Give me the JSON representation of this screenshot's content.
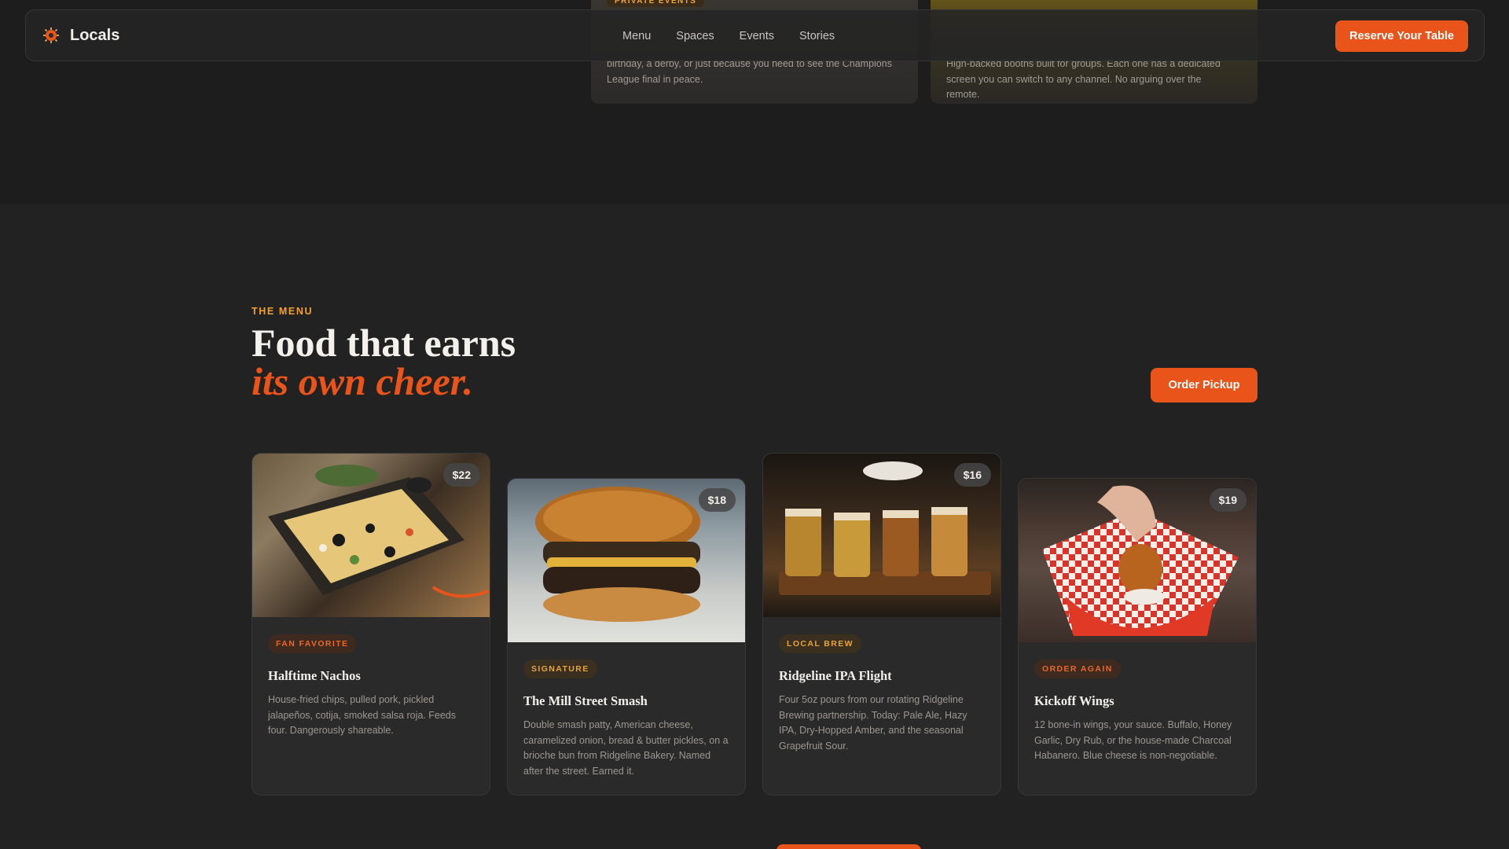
{
  "prev_section": {
    "left_card": {
      "tag": "PRIVATE EVENTS",
      "desc": "birthday, a derby, or just because you need to see the Champions League final in peace."
    },
    "right_card": {
      "desc": "High-backed booths built for groups. Each one has a dedicated screen you can switch to any channel. No arguing over the remote."
    }
  },
  "header": {
    "brand": "Locals",
    "nav": [
      "Menu",
      "Spaces",
      "Events",
      "Stories"
    ],
    "cta": "Reserve Your Table"
  },
  "menu": {
    "eyebrow": "THE MENU",
    "headline_line1": "Food that earns",
    "headline_line2": "its own cheer.",
    "order_button": "Order Pickup",
    "items": [
      {
        "badge": "FAN FAVORITE",
        "name": "Halftime Nachos",
        "price": "$22",
        "desc": "House-fried chips, pulled pork, pickled jalapeños, cotija, smoked salsa roja. Feeds four. Dangerously shareable."
      },
      {
        "badge": "SIGNATURE",
        "name": "The Mill Street Smash",
        "price": "$18",
        "desc": "Double smash patty, American cheese, caramelized onion, bread & butter pickles, on a brioche bun from Ridgeline Bakery. Named after the street. Earned it."
      },
      {
        "badge": "LOCAL BREW",
        "name": "Ridgeline IPA Flight",
        "price": "$16",
        "desc": "Four 5oz pours from our rotating Ridgeline Brewing partnership. Today: Pale Ale, Hazy IPA, Dry-Hopped Amber, and the seasonal Grapefruit Sour."
      },
      {
        "badge": "ORDER AGAIN",
        "name": "Kickoff Wings",
        "price": "$19",
        "desc": "12 bone-in wings, your sauce. Buffalo, Honey Garlic, Dry Rub, or the house-made Charcoal Habanero. Blue cheese is non-negotiable."
      }
    ]
  },
  "colors": {
    "accent": "#e8541a",
    "gold": "#f5a030",
    "background": "#222222"
  }
}
